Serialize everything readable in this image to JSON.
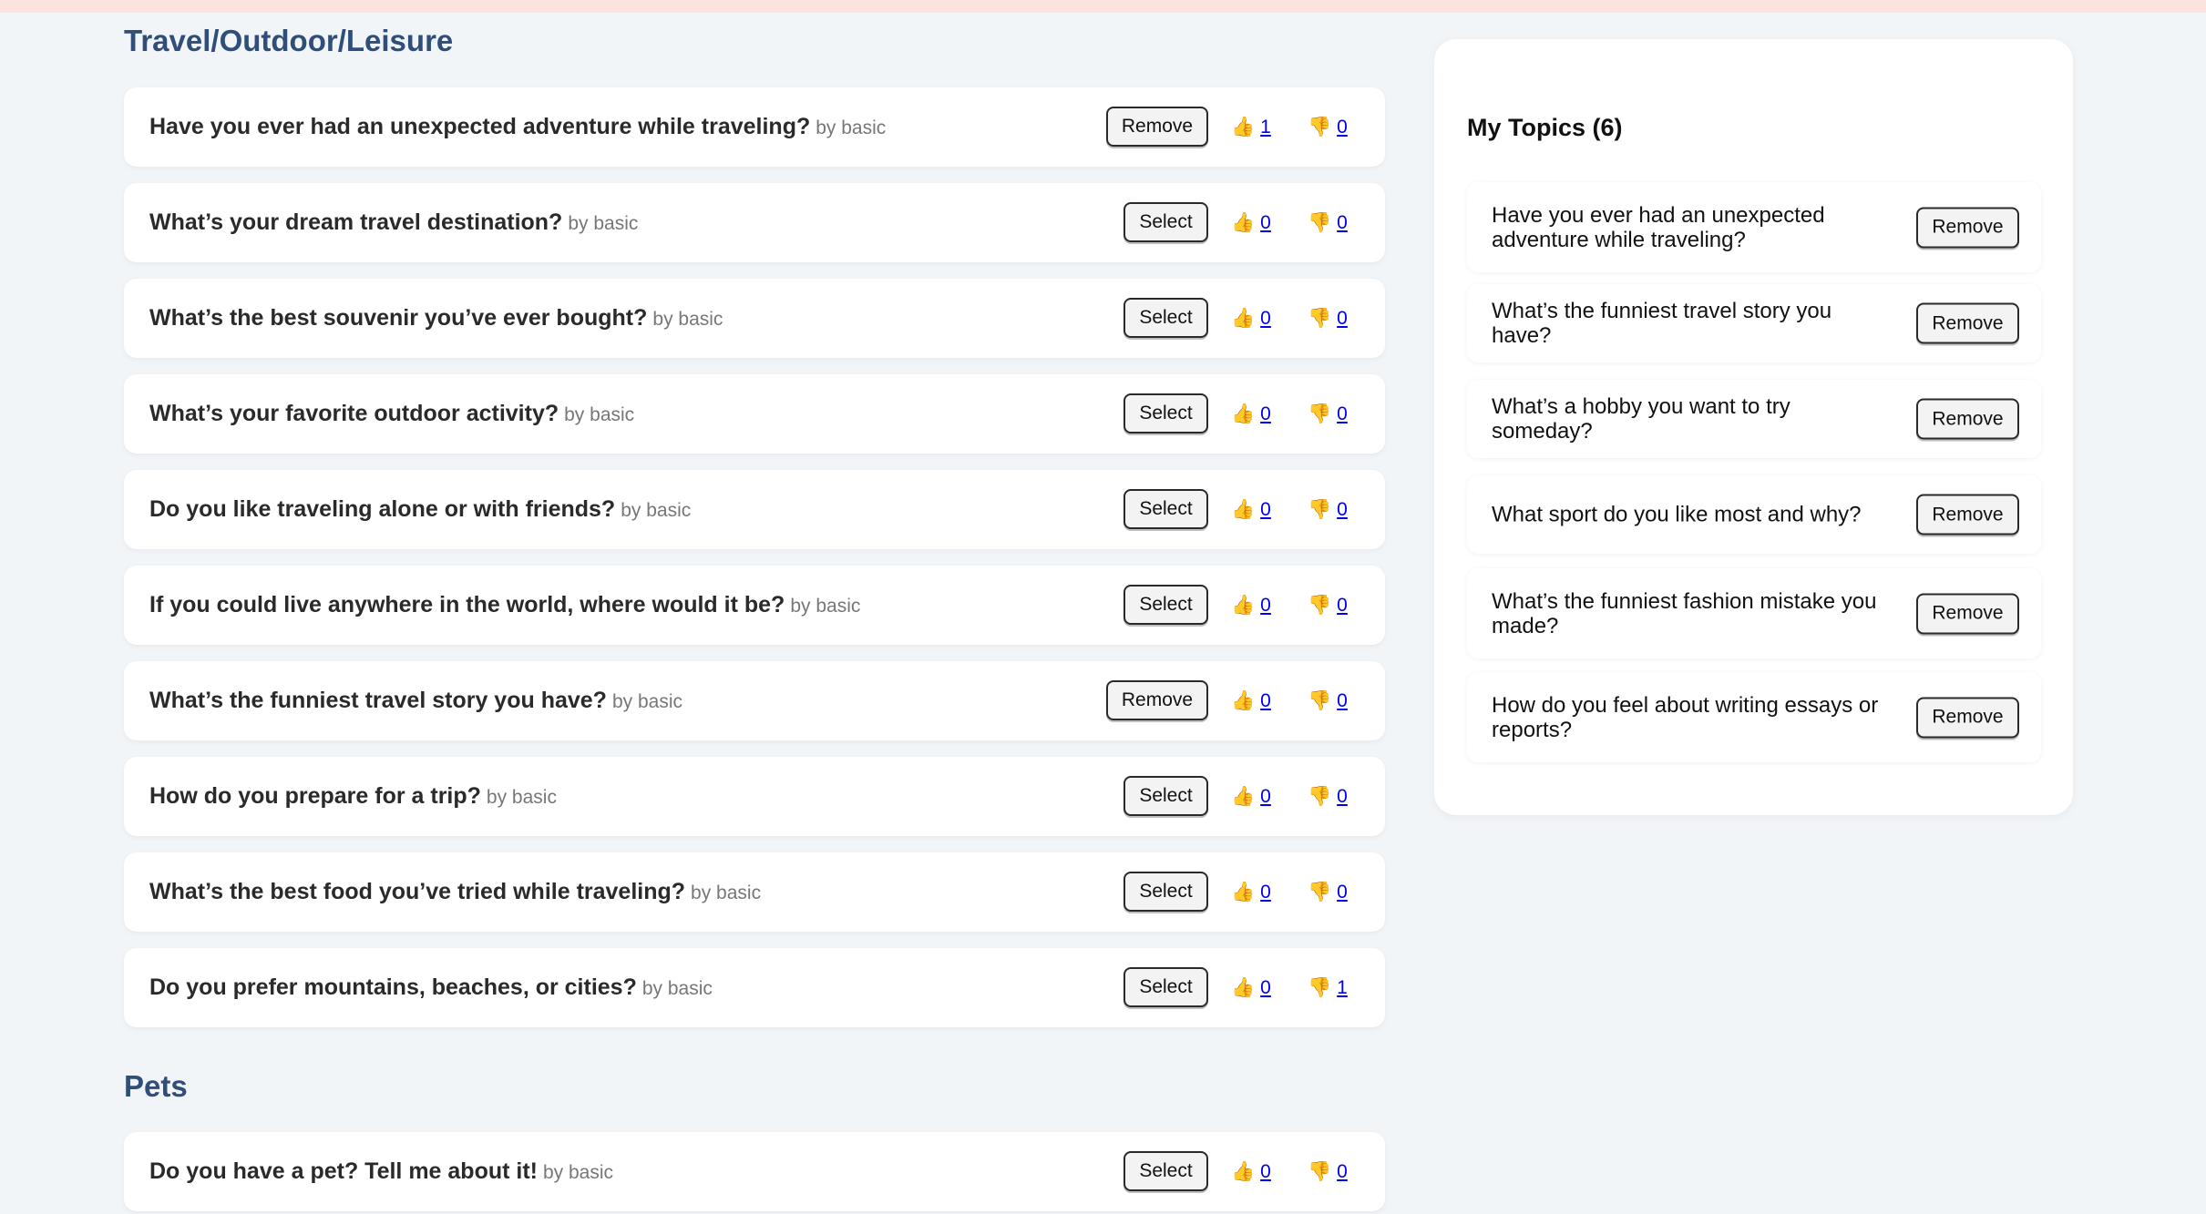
{
  "sections": [
    {
      "heading": "Travel/Outdoor/Leisure",
      "topics": [
        {
          "title": "Have you ever had an unexpected adventure while traveling?",
          "author": "by basic",
          "action": "Remove",
          "up": "1",
          "down": "0"
        },
        {
          "title": "What’s your dream travel destination?",
          "author": "by basic",
          "action": "Select",
          "up": "0",
          "down": "0"
        },
        {
          "title": "What’s the best souvenir you’ve ever bought?",
          "author": "by basic",
          "action": "Select",
          "up": "0",
          "down": "0"
        },
        {
          "title": "What’s your favorite outdoor activity?",
          "author": "by basic",
          "action": "Select",
          "up": "0",
          "down": "0"
        },
        {
          "title": "Do you like traveling alone or with friends?",
          "author": "by basic",
          "action": "Select",
          "up": "0",
          "down": "0"
        },
        {
          "title": "If you could live anywhere in the world, where would it be?",
          "author": "by basic",
          "action": "Select",
          "up": "0",
          "down": "0"
        },
        {
          "title": "What’s the funniest travel story you have?",
          "author": "by basic",
          "action": "Remove",
          "up": "0",
          "down": "0"
        },
        {
          "title": "How do you prepare for a trip?",
          "author": "by basic",
          "action": "Select",
          "up": "0",
          "down": "0"
        },
        {
          "title": "What’s the best food you’ve tried while traveling?",
          "author": "by basic",
          "action": "Select",
          "up": "0",
          "down": "0"
        },
        {
          "title": "Do you prefer mountains, beaches, or cities?",
          "author": "by basic",
          "action": "Select",
          "up": "0",
          "down": "1"
        }
      ]
    },
    {
      "heading": "Pets",
      "topics": [
        {
          "title": "Do you have a pet? Tell me about it!",
          "author": "by basic",
          "action": "Select",
          "up": "0",
          "down": "0"
        }
      ]
    }
  ],
  "vote_icons": {
    "up": "👍",
    "down": "👎"
  },
  "sidebar": {
    "title": "My Topics (6)",
    "items": [
      {
        "label": "Have you ever had an unexpected adventure while traveling?",
        "button": "Remove"
      },
      {
        "label": "What’s the funniest travel story you have?",
        "button": "Remove"
      },
      {
        "label": "What’s a hobby you want to try someday?",
        "button": "Remove"
      },
      {
        "label": "What sport do you like most and why?",
        "button": "Remove"
      },
      {
        "label": "What’s the funniest fashion mistake you made?",
        "button": "Remove"
      },
      {
        "label": "How do you feel about writing essays or reports?",
        "button": "Remove"
      }
    ]
  },
  "colors": {
    "background": "#f2f5f8",
    "heading": "#2f4f7a",
    "top_strip": "#fde3dd",
    "link": "#0000ee"
  }
}
